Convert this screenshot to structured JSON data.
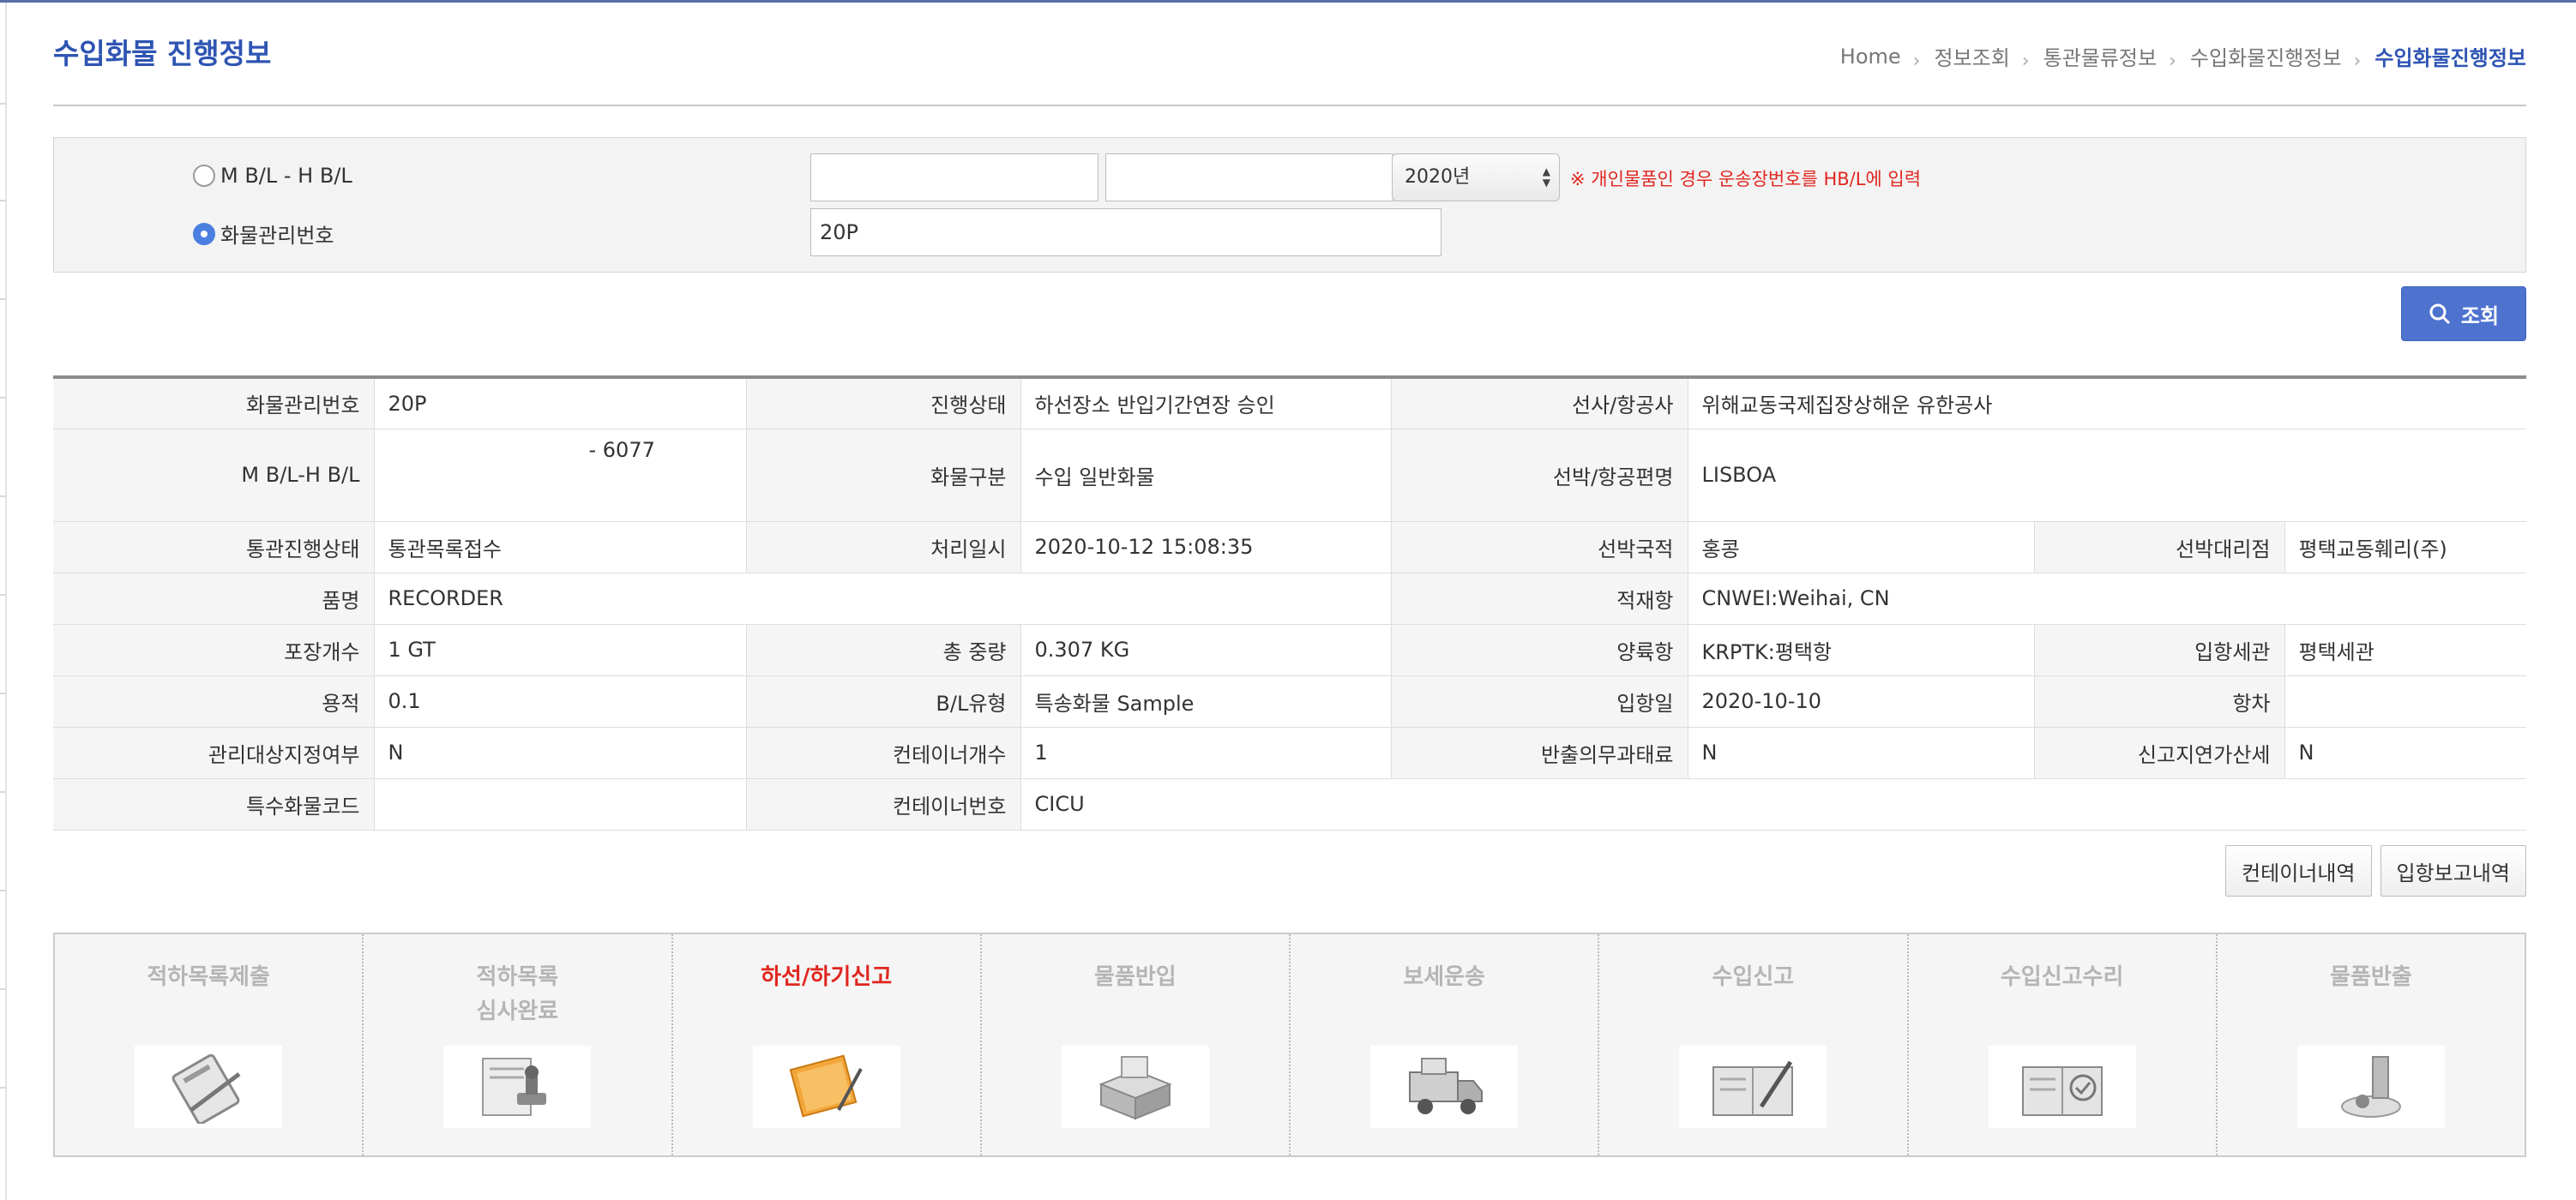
{
  "page": {
    "title": "수입화물 진행정보"
  },
  "breadcrumb": [
    "Home",
    "정보조회",
    "통관물류정보",
    "수입화물진행정보",
    "수입화물진행정보"
  ],
  "search": {
    "radio_mbl": "M B/L - H B/L",
    "radio_cargo": "화물관리번호",
    "mbl_value": "",
    "hbl_value": "",
    "year": "2020년",
    "notice": "※ 개인물품인 경우 운송장번호를 HB/L에 입력",
    "cargo_no_value": "20P",
    "button_label": "조회"
  },
  "info": {
    "cargo_no_label": "화물관리번호",
    "cargo_no": "20P",
    "status_label": "진행상태",
    "status": "하선장소 반입기간연장 승인",
    "carrier_label": "선사/항공사",
    "carrier": "위해교동국제집장상해운 유한공사",
    "mbl_label": "M B/L-H B/L",
    "mbl": "- 6077",
    "cargo_type_label": "화물구분",
    "cargo_type": "수입 일반화물",
    "vessel_label": "선박/항공편명",
    "vessel": "LISBOA",
    "customs_status_label": "통관진행상태",
    "customs_status": "통관목록접수",
    "processed_label": "처리일시",
    "processed": "2020-10-12 15:08:35",
    "vessel_country_label": "선박국적",
    "vessel_country": "홍콩",
    "agent_label": "선박대리점",
    "agent": "평택교동훼리(주)",
    "item_label": "품명",
    "item": "RECORDER",
    "loading_port_label": "적재항",
    "loading_port": "CNWEI:Weihai, CN",
    "packages_label": "포장개수",
    "packages": "1 GT",
    "weight_label": "총 중량",
    "weight": "0.307 KG",
    "unloading_port_label": "양륙항",
    "unloading_port": "KRPTK:평택항",
    "entry_customs_label": "입항세관",
    "entry_customs": "평택세관",
    "volume_label": "용적",
    "volume": "0.1",
    "bl_type_label": "B/L유형",
    "bl_type": "특송화물 Sample",
    "entry_date_label": "입항일",
    "entry_date": "2020-10-10",
    "voyage_label": "항차",
    "voyage": "",
    "managed_label": "관리대상지정여부",
    "managed": "N",
    "container_count_label": "컨테이너개수",
    "container_count": "1",
    "export_fee_label": "반출의무과태료",
    "export_fee": "N",
    "late_tax_label": "신고지연가산세",
    "late_tax": "N",
    "special_code_label": "특수화물코드",
    "special_code": "",
    "container_no_label": "컨테이너번호",
    "container_no": "CICU"
  },
  "buttons": {
    "container_history": "컨테이너내역",
    "entry_report": "입항보고내역"
  },
  "steps": [
    {
      "label": "적하목록제출",
      "icon": "clipboard-icon",
      "active": false
    },
    {
      "label": "적하목록\n심사완료",
      "icon": "stamp-icon",
      "active": false
    },
    {
      "label": "하선/하기신고",
      "icon": "folder-pen-icon",
      "active": true
    },
    {
      "label": "물품반입",
      "icon": "boxes-icon",
      "active": false
    },
    {
      "label": "보세운송",
      "icon": "truck-icon",
      "active": false
    },
    {
      "label": "수입신고",
      "icon": "document-pen-icon",
      "active": false
    },
    {
      "label": "수입신고수리",
      "icon": "document-approve-icon",
      "active": false
    },
    {
      "label": "물품반출",
      "icon": "release-icon",
      "active": false
    }
  ],
  "colors": {
    "accent": "#2f55b3",
    "button": "#4d73cf",
    "active_step": "#e0261f",
    "inactive_step": "#b5b5b5"
  }
}
